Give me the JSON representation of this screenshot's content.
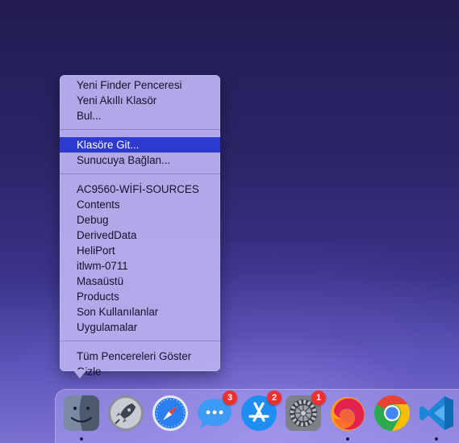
{
  "context_menu": {
    "group1": [
      "Yeni Finder Penceresi",
      "Yeni Akıllı Klasör",
      "Bul..."
    ],
    "group2": [
      "Klasöre Git...",
      "Sunucuya Bağlan..."
    ],
    "highlighted_item": "Klasöre Git...",
    "recent_folders": [
      "AC9560-WİFİ-SOURCES",
      "Contents",
      "Debug",
      "DerivedData",
      "HeliPort",
      "itlwm-0711",
      "Masaüstü",
      "Products",
      "Son Kullanılanlar",
      "Uygulamalar"
    ],
    "group4": [
      "Tüm Pencereleri Göster",
      "Gizle"
    ]
  },
  "dock": {
    "items": [
      {
        "name": "finder",
        "icon": "finder-icon",
        "running": true,
        "badge": ""
      },
      {
        "name": "launchpad",
        "icon": "launchpad-rocket-icon",
        "running": false,
        "badge": ""
      },
      {
        "name": "safari",
        "icon": "safari-compass-icon",
        "running": false,
        "badge": ""
      },
      {
        "name": "messages",
        "icon": "messages-bubble-icon",
        "running": false,
        "badge": "3"
      },
      {
        "name": "app-store",
        "icon": "app-store-icon",
        "running": false,
        "badge": "2"
      },
      {
        "name": "system-preferences",
        "icon": "gear-icon",
        "running": false,
        "badge": "1"
      },
      {
        "name": "firefox",
        "icon": "firefox-icon",
        "running": true,
        "badge": ""
      },
      {
        "name": "chrome",
        "icon": "chrome-icon",
        "running": false,
        "badge": ""
      },
      {
        "name": "vscode",
        "icon": "vscode-icon",
        "running": true,
        "badge": ""
      }
    ]
  },
  "colors": {
    "menu_highlight": "#2e39cf",
    "badge": "#ec2f2f",
    "desktop_top": "#221c52",
    "desktop_bottom": "#7a72d0"
  }
}
